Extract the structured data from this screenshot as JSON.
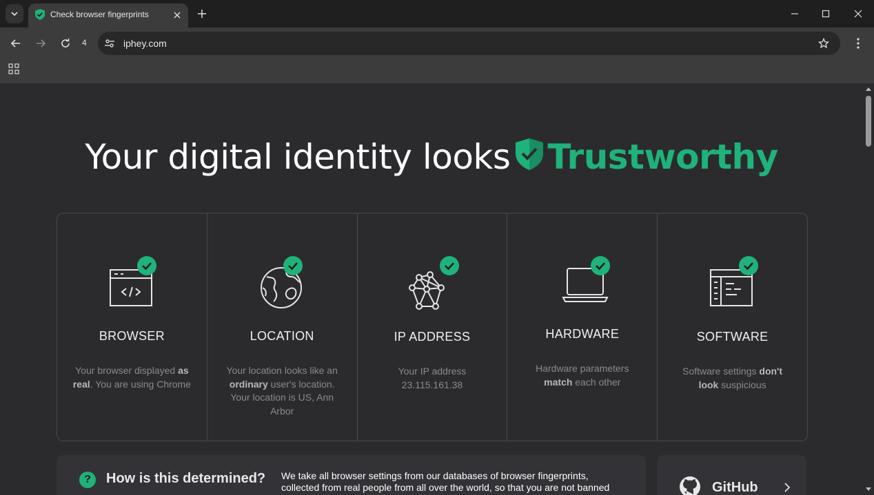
{
  "browser": {
    "tab_title": "Check browser fingerprints",
    "reload_count": "4",
    "url": "iphey.com"
  },
  "page": {
    "headline_prefix": "Your digital identity looks",
    "headline_status": "Trustworthy",
    "cards": [
      {
        "title": "BROWSER",
        "icon": "browser-code-icon",
        "desc_html": "Your browser displayed <b>as real</b>. You are using Chrome"
      },
      {
        "title": "LOCATION",
        "icon": "globe-icon",
        "desc_html": "Your location looks like an <b>ordinary</b> user's location. Your location is US, Ann Arbor"
      },
      {
        "title": "IP ADDRESS",
        "icon": "network-icon",
        "desc_html": "Your IP address 23.115.161.38"
      },
      {
        "title": "HARDWARE",
        "icon": "laptop-icon",
        "desc_html": "Hardware parameters <b>match</b> each other"
      },
      {
        "title": "SOFTWARE",
        "icon": "software-window-icon",
        "desc_html": "Software settings <b>don't look</b> suspicious"
      }
    ],
    "how_title": "How is this determined?",
    "how_text": "We take all browser settings from our databases of browser fingerprints, collected from real people from all over the world, so that you are not banned",
    "github_label": "GitHub"
  },
  "colors": {
    "accent": "#1fb27a",
    "background": "#2b2b2e"
  }
}
